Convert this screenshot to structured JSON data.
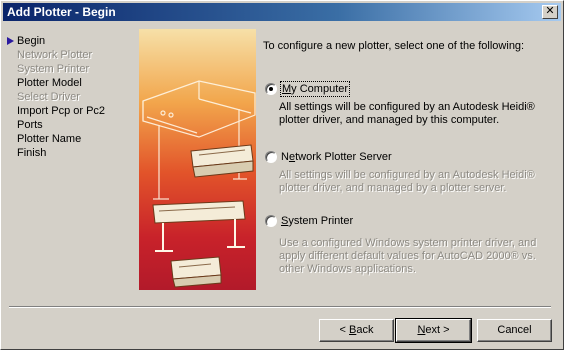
{
  "window": {
    "title": "Add Plotter - Begin",
    "close_glyph": "✕"
  },
  "steps": [
    {
      "label": "Begin",
      "state": "current"
    },
    {
      "label": "Network Plotter",
      "state": "disabled"
    },
    {
      "label": "System Printer",
      "state": "disabled"
    },
    {
      "label": "Plotter Model",
      "state": "enabled"
    },
    {
      "label": "Select Driver",
      "state": "disabled"
    },
    {
      "label": "Import Pcp or Pc2",
      "state": "enabled"
    },
    {
      "label": "Ports",
      "state": "enabled"
    },
    {
      "label": "Plotter Name",
      "state": "enabled"
    },
    {
      "label": "Finish",
      "state": "enabled"
    }
  ],
  "intro": "To configure a new plotter, select one of the following:",
  "options": [
    {
      "label_pre": "",
      "label_accel": "M",
      "label_post": "y Computer",
      "checked": true,
      "description": "All settings will be configured by an Autodesk Heidi® plotter driver, and managed by this computer.",
      "description_enabled": true
    },
    {
      "label_pre": "N",
      "label_accel": "e",
      "label_post": "twork Plotter Server",
      "checked": false,
      "description": "All settings will be configured by an Autodesk Heidi® plotter driver, and managed by a plotter server.",
      "description_enabled": false
    },
    {
      "label_pre": "",
      "label_accel": "S",
      "label_post": "ystem Printer",
      "checked": false,
      "description": "Use a configured Windows system printer driver, and apply different default values for AutoCAD 2000® vs. other Windows applications.",
      "description_enabled": false
    }
  ],
  "buttons": {
    "back": {
      "pre": "< ",
      "accel": "B",
      "post": "ack"
    },
    "next": {
      "pre": "",
      "accel": "N",
      "post": "ext >"
    },
    "cancel": "Cancel"
  },
  "colors": {
    "dialog_bg": "#d4d0c8",
    "titlebar_start": "#0a246a",
    "titlebar_end": "#a6caf0",
    "current_step_arrow": "#2b1aa0",
    "illustration_top": "#f6e0a8",
    "illustration_bottom": "#b21a2a"
  },
  "icons": {
    "current_step": "triangle-right-icon",
    "close": "close-icon"
  }
}
